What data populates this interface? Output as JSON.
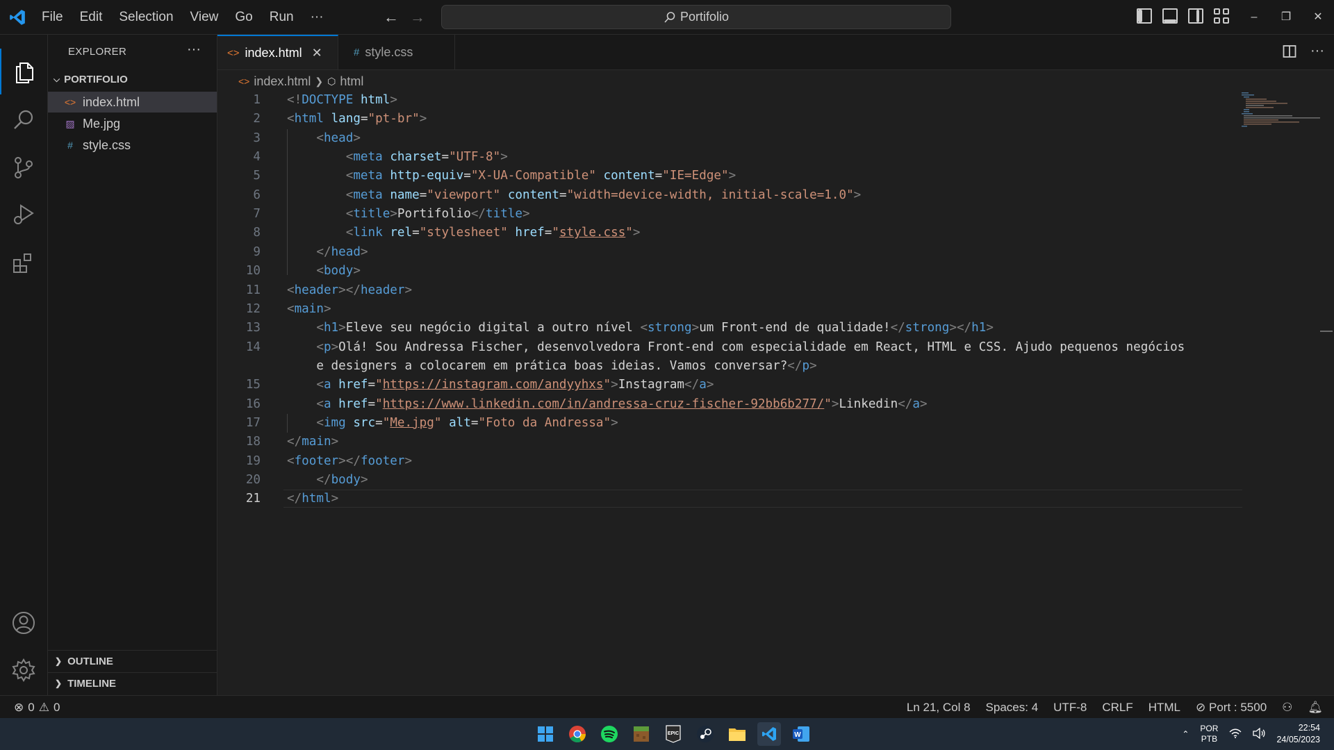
{
  "menu": [
    "File",
    "Edit",
    "Selection",
    "View",
    "Go",
    "Run",
    "···"
  ],
  "command_center": "Portifolio",
  "window_controls": [
    "–",
    "❐",
    "✕"
  ],
  "sidebar": {
    "title": "EXPLORER",
    "more": "···",
    "folder": "PORTIFOLIO",
    "files": [
      "index.html",
      "Me.jpg",
      "style.css"
    ],
    "sections": [
      "OUTLINE",
      "TIMELINE"
    ]
  },
  "tabs": [
    {
      "label": "index.html",
      "icon": "<>",
      "active": true
    },
    {
      "label": "style.css",
      "icon": "#",
      "active": false
    }
  ],
  "breadcrumb": [
    "index.html",
    "html"
  ],
  "code_lines": [
    "1",
    "2",
    "3",
    "4",
    "5",
    "6",
    "7",
    "8",
    "9",
    "10",
    "11",
    "12",
    "13",
    "14",
    "",
    "15",
    "16",
    "17",
    "18",
    "19",
    "20",
    "21"
  ],
  "code_text": {
    "doctype": "html",
    "lang": "\"pt-br\"",
    "charset": "\"UTF-8\"",
    "http_equiv": "\"X-UA-Compatible\"",
    "edge": "\"IE=Edge\"",
    "viewport_name": "\"viewport\"",
    "viewport_content": "\"width=device-width, initial-scale=1.0\"",
    "title": "Portifolio",
    "rel": "\"stylesheet\"",
    "href_q1": "\"",
    "href_css": "style.css",
    "h1_text": "Eleve seu negócio digital a outro nível ",
    "strong_text": "um Front-end de qualidade!",
    "p_text1": "Olá! Sou Andressa Fischer, desenvolvedora Front-end com especialidade em React, HTML e CSS. Ajudo pequenos negócios",
    "p_text2": "e designers a colocarem em prática boas ideias. Vamos conversar?",
    "instagram_url": "https://instagram.com/andyyhxs",
    "instagram_label": "Instagram",
    "linkedin_url": "https://www.linkedin.com/in/andressa-cruz-fischer-92bb6b277/",
    "linkedin_label": "Linkedin",
    "img_src": "Me.jpg",
    "img_alt": "\"Foto da Andressa\""
  },
  "status": {
    "errors": "0",
    "warnings": "0",
    "position": "Ln 21, Col 8",
    "spaces": "Spaces: 4",
    "encoding": "UTF-8",
    "eol": "CRLF",
    "language": "HTML",
    "port": "Port : 5500"
  },
  "tray": {
    "lang1": "POR",
    "lang2": "PTB",
    "time": "22:54",
    "date": "24/05/2023"
  },
  "colors": {
    "accent": "#0078d4",
    "tag": "#569cd6",
    "attribute": "#9cdcfe",
    "string": "#ce9178"
  }
}
